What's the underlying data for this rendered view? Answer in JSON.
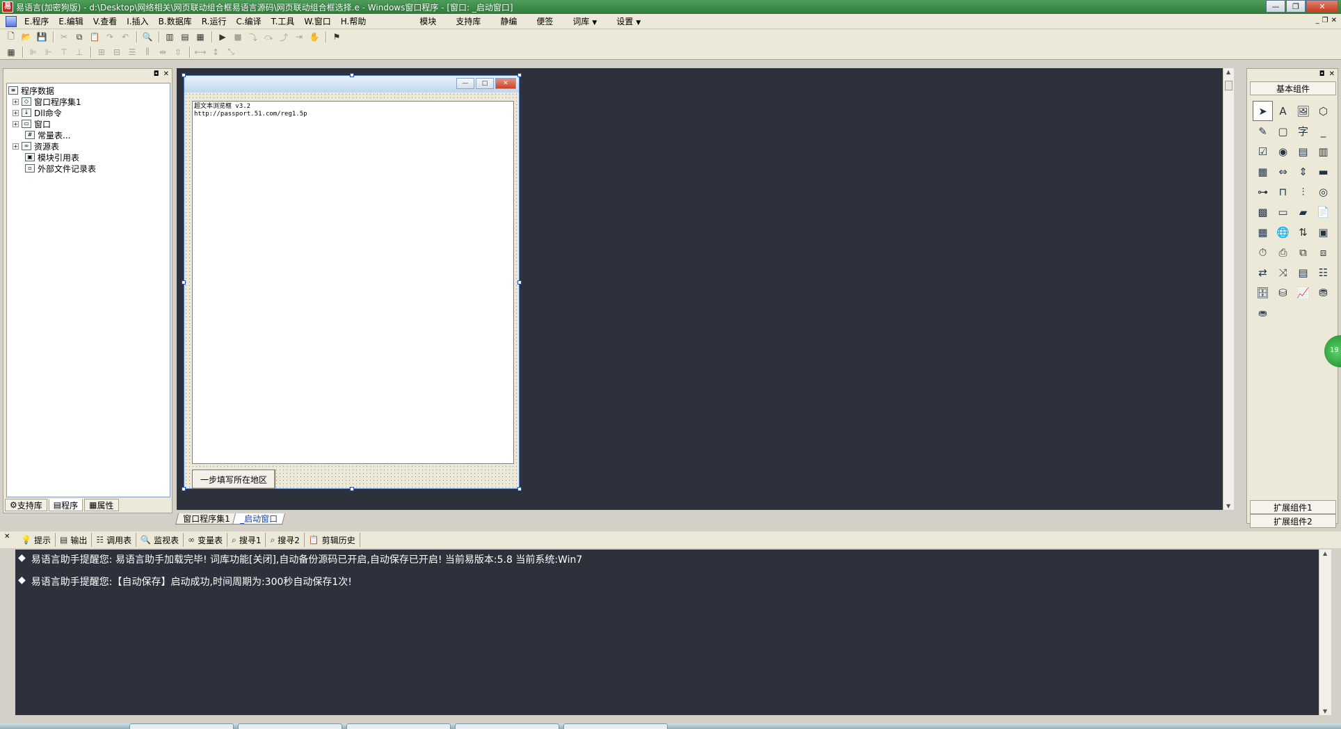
{
  "window": {
    "title": "易语言(加密狗版) - d:\\Desktop\\网络相关\\网页联动组合框易语言源码\\网页联动组合框选择.e - Windows窗口程序 - [窗口: _启动窗口]",
    "min": "—",
    "max": "❐",
    "close": "✕"
  },
  "menu": {
    "items": [
      "E.程序",
      "E.编辑",
      "V.查看",
      "I.插入",
      "B.数据库",
      "R.运行",
      "C.编译",
      "T.工具",
      "W.窗口",
      "H.帮助"
    ],
    "extra": [
      "模块",
      "支持库",
      "静编",
      "便签",
      "词库",
      "设置"
    ],
    "caret": "▼"
  },
  "left_panel": {
    "tree": {
      "root": "程序数据",
      "items": [
        "窗口程序集1",
        "Dll命令",
        "窗口",
        "常量表...",
        "资源表",
        "模块引用表",
        "外部文件记录表"
      ]
    },
    "tabs": [
      "支持库",
      "程序",
      "属性"
    ]
  },
  "design_form": {
    "browser_text_line1": "超文本浏览框 v3.2",
    "browser_text_line2": "http://passport.51.com/reg1.5p",
    "button_label": "一步填写所在地区"
  },
  "workspace_tabs": [
    "窗口程序集1",
    "_启动窗口"
  ],
  "toolbox": {
    "header": "基本组件",
    "footer1": "扩展组件1",
    "footer2": "扩展组件2",
    "badge": "19"
  },
  "output": {
    "tabs": [
      "提示",
      "输出",
      "调用表",
      "监视表",
      "变量表",
      "搜寻1",
      "搜寻2",
      "剪辑历史"
    ],
    "bullet": "◆",
    "lines": [
      "易语言助手提醒您:  易语言助手加载完毕!  词库功能[关闭],自动备份源码已开启,自动保存已开启!  当前易版本:5.8  当前系统:Win7",
      "易语言助手提醒您:【自动保存】启动成功,时间周期为:300秒自动保存1次!"
    ]
  },
  "colors": {
    "titlebar": "#3b8a47",
    "workspace": "#2d313b",
    "chrome": "#ece9d8"
  }
}
